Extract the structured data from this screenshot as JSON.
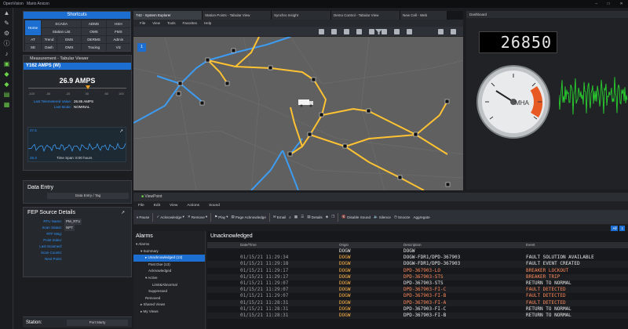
{
  "app": {
    "title": "OpenVision",
    "user": "Mario Anicon"
  },
  "left_tools": [
    "up-arrow-icon",
    "wrench-icon",
    "gear-icon",
    "info-icon",
    "bell-icon",
    "monitor-icon",
    "tag-icon",
    "tag-icon",
    "plugin-icon",
    "bookmark-icon"
  ],
  "shortcuts": {
    "title": "Shortcuts",
    "home": "Home",
    "rows": [
      [
        "",
        "SCADA",
        "ADMS",
        "HSH"
      ],
      [
        "",
        "Station List",
        "OMS",
        "FMS"
      ],
      [
        "AT",
        "Trend",
        "EMS",
        "DERMS",
        "Admin"
      ],
      [
        "SE",
        "Dash",
        "OMS",
        "Tracing",
        "Viz"
      ]
    ]
  },
  "measurement": {
    "title": "Measurement - Tabular Viewer",
    "point": "Y162 AMPS (W)",
    "value": "26.9 AMPS",
    "scale": [
      "-100",
      "-50",
      "-20",
      "30",
      "80",
      "100"
    ],
    "rows": [
      {
        "k": "Last Telemetered Value:",
        "v": "26.85 AMPS"
      },
      {
        "k": "Last Mode:",
        "v": "NOMINAL"
      }
    ],
    "spark_top": "27.5",
    "spark_bottom": "26.3",
    "timespan": "Time Span: 8:00 hours"
  },
  "data_entry": {
    "title": "Data Entry",
    "button": "Data Entry / Tag"
  },
  "fep": {
    "title": "FEP Source Details",
    "rows": [
      {
        "k": "RTU Name:",
        "v": "PM_RTU"
      },
      {
        "k": "Scan Status:",
        "v": "NPT"
      },
      {
        "k": "RTF Msg:",
        "v": ""
      },
      {
        "k": "Point Index:",
        "v": ""
      },
      {
        "k": "Last Scanned:",
        "v": ""
      },
      {
        "k": "Scan Counts:",
        "v": ""
      },
      {
        "k": "Next Point:",
        "v": ""
      }
    ]
  },
  "station": {
    "label": "Station:",
    "value": "Port Marty"
  },
  "tabs": [
    "T42 - System Explorer",
    "Station Points - Tabular View",
    "Synchro Insight",
    "Demo Control - Tabular View",
    "New Cell - Web"
  ],
  "map_menu": [
    "File",
    "View",
    "Tools",
    "Favorites",
    "Help"
  ],
  "map": {
    "marker": "1"
  },
  "dashboard": {
    "title": "Dashboard",
    "lcd": "26850",
    "gauge_label": "MHA"
  },
  "viewpoint": {
    "title": "ViewPoint",
    "menu": [
      "File",
      "Edit",
      "View",
      "Actions",
      "Sound"
    ],
    "toolbar": [
      "Pause",
      "Acknowledge",
      "Remove",
      "Play",
      "Page Acknowledge",
      "Email",
      "Details",
      "Disable Sound",
      "Silence",
      "Snooze",
      "Aggregate"
    ],
    "all_buttons": [
      "All",
      "1"
    ]
  },
  "alarms": {
    "title": "Alarms",
    "tree": [
      "Alarms",
      "Summary",
      "Unacknowledged (13)",
      "Past Due (13)",
      "Acknowledged",
      "Active",
      "Limit&Abnormal",
      "Suppressed",
      "Removed",
      "Shared Views",
      "My Views"
    ]
  },
  "grid": {
    "title": "Unacknowledged",
    "headers": [
      "",
      "",
      "",
      "Date/Time",
      "Origin",
      "Description",
      "Event"
    ],
    "filter": {
      "origin": "DOGW",
      "desc": "DOGW"
    },
    "rows": [
      {
        "dt": "01/15/21 11:29:34",
        "o": "DOGW",
        "d": "DOGW-FDR1/DPD-367903",
        "e": "FAULT SOLUTION AVAILABLE",
        "c": "#e6e6e6"
      },
      {
        "dt": "01/15/21 11:29:18",
        "o": "DOGW",
        "d": "DOGW-FDR1/DPD-367903",
        "e": "FAULT EVENT CREATED",
        "c": "#e6e6e6"
      },
      {
        "dt": "01/15/21 11:29:17",
        "o": "DOGW",
        "d": "DPD-367903-LO",
        "e": "BREAKER LOCKOUT",
        "c": "#ff8a5c"
      },
      {
        "dt": "01/15/21 11:29:17",
        "o": "DOGW",
        "d": "DPD-367903-STS",
        "e": "BREAKER TRIP",
        "c": "#ff8a5c"
      },
      {
        "dt": "01/15/21 11:29:07",
        "o": "DOGW",
        "d": "DPD-367903-STS",
        "e": "RETURN TO NORMAL",
        "c": "#e6e6e6"
      },
      {
        "dt": "01/15/21 11:29:07",
        "o": "DOGW",
        "d": "DPD-367903-FI-C",
        "e": "FAULT DETECTED",
        "c": "#ff8a5c"
      },
      {
        "dt": "01/15/21 11:29:07",
        "o": "DOGW",
        "d": "DPD-367903-FI-B",
        "e": "FAULT DETECTED",
        "c": "#ff8a5c"
      },
      {
        "dt": "01/15/21 11:28:31",
        "o": "DOGW",
        "d": "DPD-367903-FI-A",
        "e": "FAULT DETECTED",
        "c": "#ff8a5c"
      },
      {
        "dt": "01/15/21 11:28:31",
        "o": "DOGW",
        "d": "DPD-367903-FI-C",
        "e": "RETURN TO NORMAL",
        "c": "#e6e6e6"
      },
      {
        "dt": "01/15/21 11:28:31",
        "o": "DOGW",
        "d": "DPD-367903-FI-B",
        "e": "RETURN TO NORMAL",
        "c": "#e6e6e6"
      }
    ]
  },
  "colors": {
    "accent": "#1c6fd1",
    "alarm": "#ff8a5c",
    "origin": "#ffb347",
    "line_orange": "#ffc233",
    "line_blue": "#3d9bf2"
  }
}
